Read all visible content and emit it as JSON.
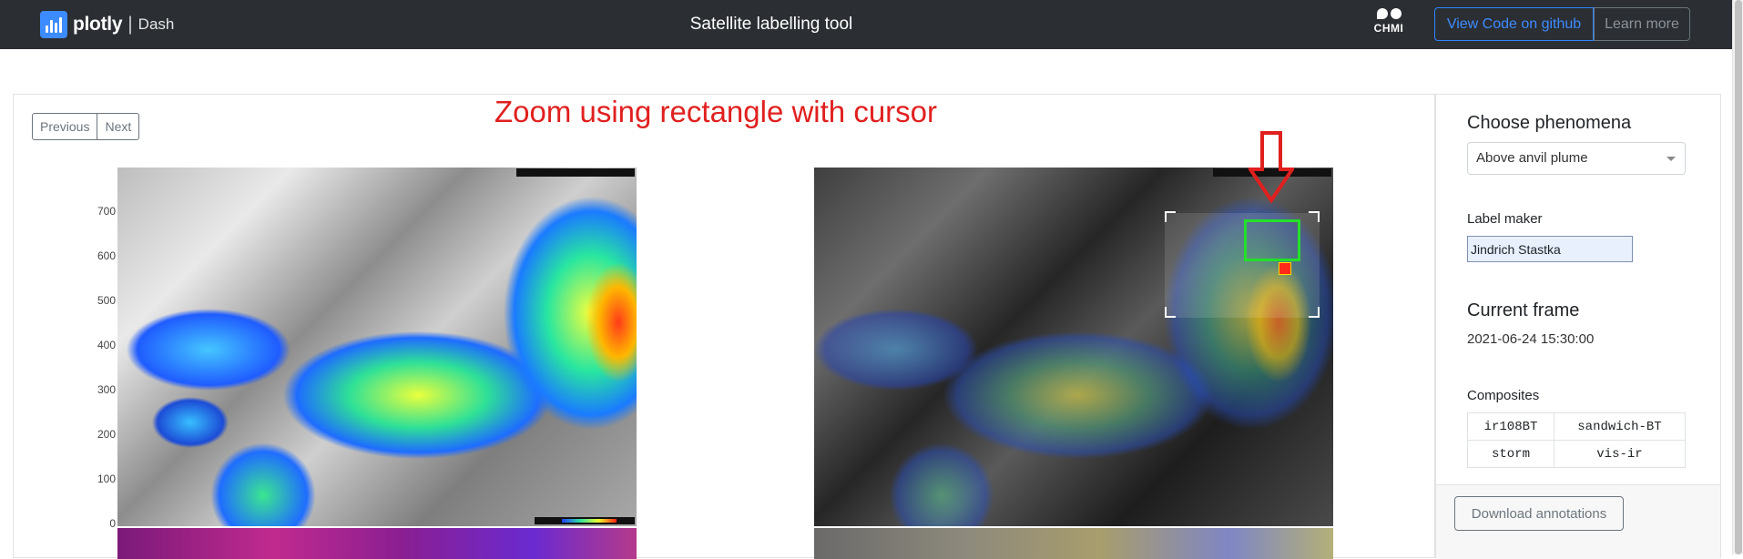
{
  "navbar": {
    "brand_name": "plotly",
    "brand_sep": "|",
    "brand_product": "Dash",
    "title": "Satellite labelling tool",
    "partner_logo_text": "CHMI",
    "github_button": "View Code on github",
    "learn_button": "Learn more"
  },
  "main": {
    "pager": {
      "prev": "Previous",
      "next": "Next"
    },
    "hint": "Zoom using rectangle with cursor",
    "yaxis_ticks": [
      "700",
      "600",
      "500",
      "400",
      "300",
      "200",
      "100",
      "0"
    ]
  },
  "sidebar": {
    "phenomena_title": "Choose phenomena",
    "phenomena_selected": "Above anvil plume",
    "label_maker_title": "Label maker",
    "label_maker_value": "Jindrich Stastka",
    "current_frame_title": "Current frame",
    "current_frame_value": "2021-06-24 15:30:00",
    "composites_title": "Composites",
    "composites": [
      [
        "ir108BT",
        "sandwich-BT"
      ],
      [
        "storm",
        "vis-ir"
      ]
    ],
    "download_button": "Download annotations"
  },
  "colors": {
    "navbar_bg": "#2b2e33",
    "accent": "#3d8cff",
    "hint": "#e0201f",
    "zoom_box": "#23e02a"
  }
}
